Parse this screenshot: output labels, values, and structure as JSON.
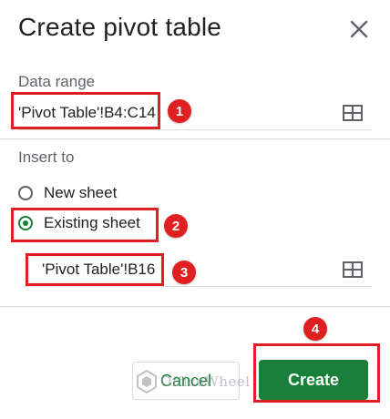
{
  "dialog": {
    "title": "Create pivot table",
    "close_icon": "close-icon"
  },
  "data_range": {
    "label": "Data range",
    "value": "'Pivot Table'!B4:C14",
    "icon": "grid-select-icon"
  },
  "insert_to": {
    "label": "Insert to",
    "options": [
      {
        "label": "New sheet",
        "checked": false
      },
      {
        "label": "Existing sheet",
        "checked": true
      }
    ],
    "location_value": "'Pivot Table'!B16",
    "icon": "grid-select-icon"
  },
  "buttons": {
    "cancel": "Cancel",
    "create": "Create"
  },
  "annotations": {
    "badges": [
      "1",
      "2",
      "3",
      "4"
    ],
    "color": "#e02020"
  },
  "watermark": {
    "text": "OfficeWheel"
  },
  "colors": {
    "accent": "#188038",
    "divider": "#dadce0",
    "annotation": "#e02020"
  }
}
